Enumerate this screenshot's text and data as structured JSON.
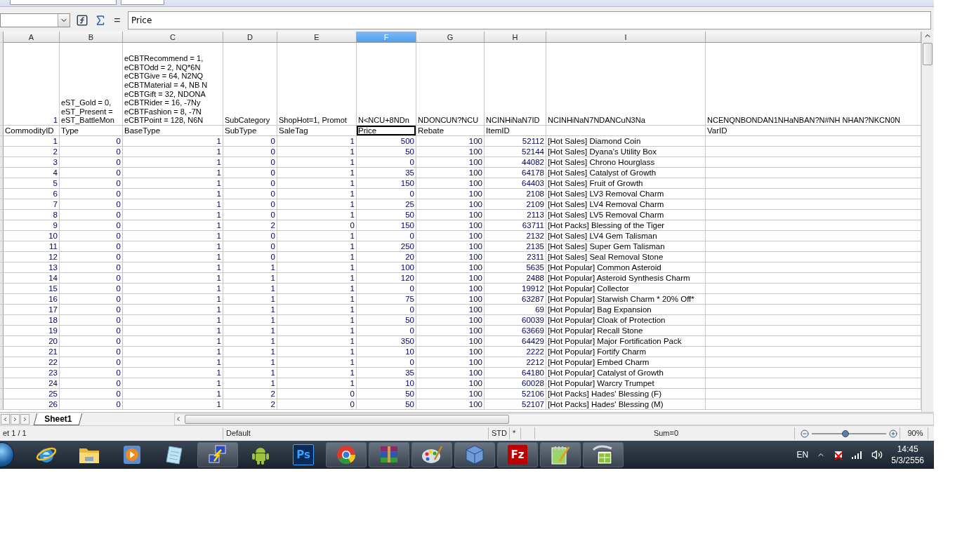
{
  "formula_bar": {
    "equals": "=",
    "formula": "Price"
  },
  "table": {
    "columns": [
      {
        "label": "A",
        "selected": false,
        "kind": "number"
      },
      {
        "label": "B",
        "selected": false,
        "kind": "number"
      },
      {
        "label": "C",
        "selected": false,
        "kind": "number"
      },
      {
        "label": "D",
        "selected": false,
        "kind": "number"
      },
      {
        "label": "E",
        "selected": false,
        "kind": "number"
      },
      {
        "label": "F",
        "selected": true,
        "kind": "number"
      },
      {
        "label": "G",
        "selected": false,
        "kind": "number"
      },
      {
        "label": "H",
        "selected": false,
        "kind": "number"
      },
      {
        "label": "I",
        "selected": false,
        "kind": "text"
      },
      {
        "selected": false,
        "kind": "text"
      }
    ],
    "heading_rows": [
      {
        "cells": [
          {
            "lines": [
              "1"
            ],
            "kind": "number",
            "selected": false
          },
          {
            "lines": [
              "eST_Gold = 0,",
              "eST_Present =",
              "eST_BattleMon"
            ],
            "kind": "text",
            "selected": false
          },
          {
            "lines": [
              "eCBTRecommend = 1,",
              "eCBTOdd = 2,  NQ*6N",
              "eCBTGive = 64,  N2NQ",
              "eCBTMaterial = 4, NB N",
              "eCBTGift = 32, NDONA",
              "eCBTRider = 16,  -7Ny",
              "eCBTFashion = 8, -7N",
              "eCBTPoint = 128, N6N"
            ],
            "kind": "text",
            "selected": false
          },
          {
            "lines": [
              "SubCategory"
            ],
            "kind": "text",
            "selected": false
          },
          {
            "lines": [
              "ShopHot=1, Promot"
            ],
            "kind": "text",
            "selected": false
          },
          {
            "lines": [
              "N<NCU+8NDn"
            ],
            "kind": "text",
            "selected": false
          },
          {
            "lines": [
              "NDONCUN?NCU"
            ],
            "kind": "text",
            "selected": false
          },
          {
            "lines": [
              "NCINHiNaN7ID"
            ],
            "kind": "text",
            "selected": false
          },
          {
            "lines": [
              "NCINHiNaN7NDANCuN3Na"
            ],
            "kind": "text",
            "selected": false
          },
          {
            "lines": [
              "NCENQNBONDAN1NHaNBAN?N#NH NHAN?NKCN0N"
            ],
            "kind": "text",
            "selected": false
          }
        ]
      },
      {
        "cells": [
          {
            "lines": [
              "CommodityID"
            ],
            "kind": "text",
            "selected": false
          },
          {
            "lines": [
              "Type"
            ],
            "kind": "text",
            "selected": false
          },
          {
            "lines": [
              "BaseType"
            ],
            "kind": "text",
            "selected": false
          },
          {
            "lines": [
              "SubType"
            ],
            "kind": "text",
            "selected": false
          },
          {
            "lines": [
              "SaleTag"
            ],
            "kind": "text",
            "selected": false
          },
          {
            "lines": [
              "Price"
            ],
            "kind": "text",
            "selected": true
          },
          {
            "lines": [
              "Rebate"
            ],
            "kind": "text",
            "selected": false
          },
          {
            "lines": [
              "ItemID"
            ],
            "kind": "text",
            "selected": false
          },
          {
            "kind": "text",
            "selected": false
          },
          {
            "lines": [
              "VarID"
            ],
            "kind": "text",
            "selected": false
          }
        ]
      }
    ],
    "rows": [
      [
        "1",
        "0",
        "1",
        "0",
        "1",
        "500",
        "100",
        "52112",
        "[Hot Sales] Diamond Coin"
      ],
      [
        "2",
        "0",
        "1",
        "0",
        "1",
        "50",
        "100",
        "52144",
        "[Hot Sales] Dyana's Utility Box"
      ],
      [
        "3",
        "0",
        "1",
        "0",
        "1",
        "0",
        "100",
        "44082",
        "[Hot Sales] Chrono Hourglass"
      ],
      [
        "4",
        "0",
        "1",
        "0",
        "1",
        "35",
        "100",
        "64178",
        "[Hot Sales] Catalyst of Growth"
      ],
      [
        "5",
        "0",
        "1",
        "0",
        "1",
        "150",
        "100",
        "64403",
        "[Hot Sales] Fruit of Growth"
      ],
      [
        "6",
        "0",
        "1",
        "0",
        "1",
        "0",
        "100",
        "2108",
        "[Hot Sales] LV3 Removal Charm"
      ],
      [
        "7",
        "0",
        "1",
        "0",
        "1",
        "25",
        "100",
        "2109",
        "[Hot Sales] LV4 Removal Charm"
      ],
      [
        "8",
        "0",
        "1",
        "0",
        "1",
        "50",
        "100",
        "2113",
        "[Hot Sales] LV5 Removal Charm"
      ],
      [
        "9",
        "0",
        "1",
        "2",
        "0",
        "150",
        "100",
        "63711",
        "[Hot Packs] Blessing of the Tiger"
      ],
      [
        "10",
        "0",
        "1",
        "0",
        "1",
        "0",
        "100",
        "2132",
        "[Hot Sales] LV4 Gem Talisman"
      ],
      [
        "11",
        "0",
        "1",
        "0",
        "1",
        "250",
        "100",
        "2135",
        "[Hot Sales] Super Gem Talisman"
      ],
      [
        "12",
        "0",
        "1",
        "0",
        "1",
        "20",
        "100",
        "2311",
        "[Hot Sales] Seal Removal Stone"
      ],
      [
        "13",
        "0",
        "1",
        "1",
        "1",
        "100",
        "100",
        "5635",
        "[Hot Popular] Common Asteroid"
      ],
      [
        "14",
        "0",
        "1",
        "1",
        "1",
        "120",
        "100",
        "2488",
        "[Hot Popular] Asteroid Synthesis Charm"
      ],
      [
        "15",
        "0",
        "1",
        "1",
        "1",
        "0",
        "100",
        "19912",
        "[Hot Popular] Collector"
      ],
      [
        "16",
        "0",
        "1",
        "1",
        "1",
        "75",
        "100",
        "63287",
        "[Hot Popular] Starwish Charm * 20% Off*"
      ],
      [
        "17",
        "0",
        "1",
        "1",
        "1",
        "0",
        "100",
        "69",
        "[Hot Popular] Bag Expansion"
      ],
      [
        "18",
        "0",
        "1",
        "1",
        "1",
        "50",
        "100",
        "60039",
        "[Hot Popular] Cloak of Protection"
      ],
      [
        "19",
        "0",
        "1",
        "1",
        "1",
        "0",
        "100",
        "63669",
        "[Hot Popular] Recall Stone"
      ],
      [
        "20",
        "0",
        "1",
        "1",
        "1",
        "350",
        "100",
        "64429",
        "[Hot Popular] Major Fortification Pack"
      ],
      [
        "21",
        "0",
        "1",
        "1",
        "1",
        "10",
        "100",
        "2222",
        "[Hot Popular] Fortify Charm"
      ],
      [
        "22",
        "0",
        "1",
        "1",
        "1",
        "0",
        "100",
        "2212",
        "[Hot Popular] Embed Charm"
      ],
      [
        "23",
        "0",
        "1",
        "1",
        "1",
        "35",
        "100",
        "64180",
        "[Hot Popular] Catalyst of Growth"
      ],
      [
        "24",
        "0",
        "1",
        "1",
        "1",
        "10",
        "100",
        "60028",
        "[Hot Popular] Warcry Trumpet"
      ],
      [
        "25",
        "0",
        "1",
        "2",
        "0",
        "50",
        "100",
        "52106",
        "[Hot Packs] Hades' Blessing (F)"
      ],
      [
        "26",
        "0",
        "1",
        "2",
        "0",
        "50",
        "100",
        "52107",
        "[Hot Packs] Hades' Blessing (M)"
      ]
    ]
  },
  "sheet_tabs": [
    {
      "label": "Sheet1",
      "selected": true
    }
  ],
  "status_bar": {
    "sheet": "et 1 / 1",
    "style": "Default",
    "mode": "STD",
    "modified": "*",
    "sum": "Sum=0",
    "zoom": {
      "level": 0.45,
      "reading": "90%"
    }
  },
  "taskbar": {
    "items": [
      {
        "kind": "browser",
        "selected": false
      },
      {
        "kind": "folder",
        "selected": false
      },
      {
        "kind": "player",
        "selected": false
      },
      {
        "kind": "notepad",
        "selected": false
      },
      {
        "kind": "network",
        "selected": true
      },
      {
        "kind": "android",
        "selected": false
      },
      {
        "kind": "photoshop",
        "label": "Ps",
        "selected": false
      },
      {
        "kind": "chrome",
        "selected": true
      },
      {
        "kind": "archive",
        "selected": true
      },
      {
        "kind": "paint",
        "selected": true
      },
      {
        "kind": "cube",
        "selected": true
      },
      {
        "kind": "ftp",
        "label": "Fz",
        "selected": true
      },
      {
        "kind": "editor",
        "selected": true
      },
      {
        "kind": "calc",
        "selected": true
      }
    ],
    "language": "EN",
    "time": "14:45",
    "date": "5/3/2556"
  }
}
